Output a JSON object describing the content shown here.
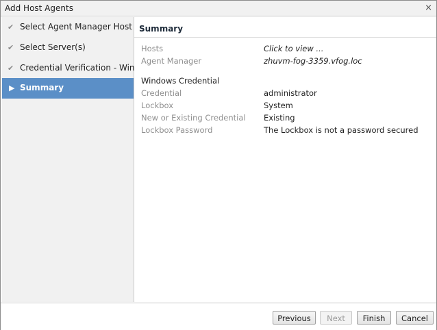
{
  "window": {
    "title": "Add Host Agents",
    "close_glyph": "×"
  },
  "sidebar": {
    "items": [
      {
        "label": "Select Agent Manager Host",
        "icon": "check-icon"
      },
      {
        "label": "Select Server(s)",
        "icon": "check-icon"
      },
      {
        "label": "Credential Verification - Windows",
        "icon": "check-icon"
      },
      {
        "label": "Summary",
        "icon": "arrow-right-icon",
        "active": true
      }
    ]
  },
  "summary": {
    "heading": "Summary",
    "hosts": {
      "label": "Hosts",
      "value": "Click to view ..."
    },
    "agent_manager": {
      "label": "Agent Manager",
      "value": "zhuvm-fog-3359.vfog.local"
    },
    "windows_credential_section": "Windows Credential",
    "credential": {
      "label": "Credential",
      "value": "administrator"
    },
    "lockbox": {
      "label": "Lockbox",
      "value": "System"
    },
    "new_or_existing": {
      "label": "New or Existing Credential",
      "value": "Existing"
    },
    "lockbox_password": {
      "label": "Lockbox Password",
      "value": "The Lockbox is not a password secured"
    }
  },
  "footer": {
    "previous_label": "Previous",
    "next_label": "Next",
    "finish_label": "Finish",
    "cancel_label": "Cancel"
  },
  "colors": {
    "active_item": "#5b8fc7",
    "sidebar_bg": "#f1f1f1"
  }
}
